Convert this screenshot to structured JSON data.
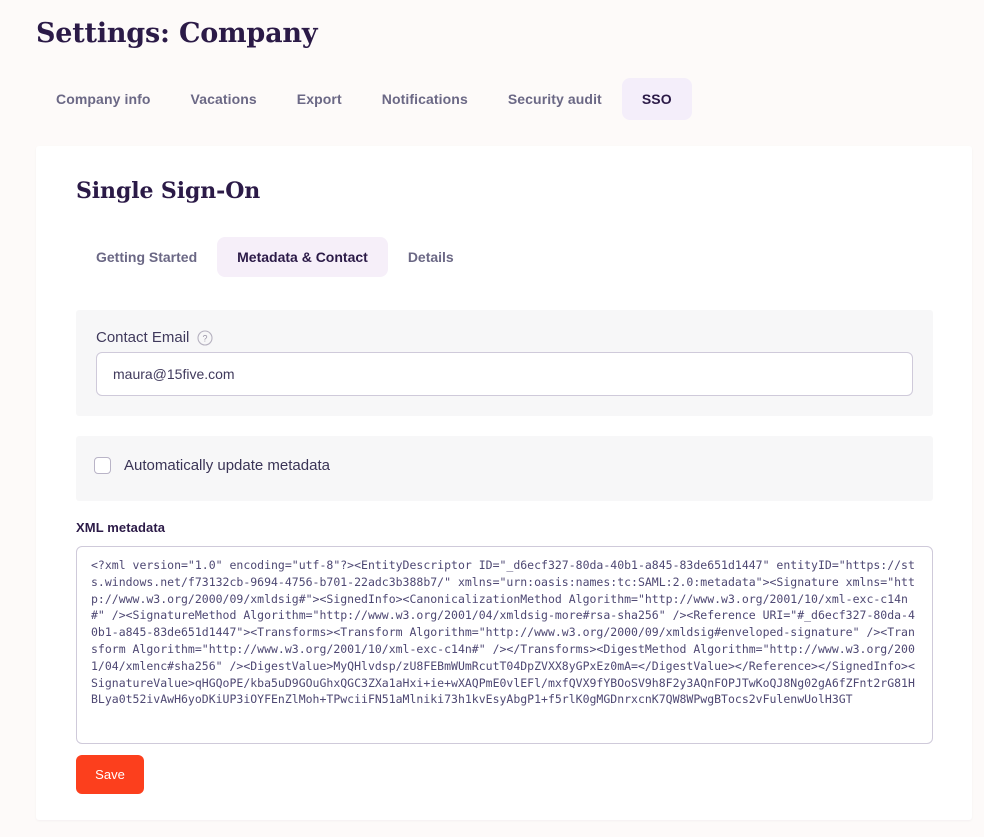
{
  "header": {
    "title": "Settings: Company",
    "tabs": [
      {
        "label": "Company info",
        "active": false
      },
      {
        "label": "Vacations",
        "active": false
      },
      {
        "label": "Export",
        "active": false
      },
      {
        "label": "Notifications",
        "active": false
      },
      {
        "label": "Security audit",
        "active": false
      },
      {
        "label": "SSO",
        "active": true
      }
    ]
  },
  "card": {
    "title": "Single Sign-On",
    "sub_tabs": [
      {
        "label": "Getting Started",
        "active": false
      },
      {
        "label": "Metadata & Contact",
        "active": true
      },
      {
        "label": "Details",
        "active": false
      }
    ],
    "contact_email": {
      "label": "Contact Email",
      "help_icon": "help-circle-icon",
      "value": "maura@15five.com",
      "placeholder": "Contact Email"
    },
    "auto_update": {
      "label": "Automatically update metadata",
      "checked": false
    },
    "xml_metadata": {
      "label": "XML metadata",
      "value": "<?xml version=\"1.0\" encoding=\"utf-8\"?><EntityDescriptor ID=\"_d6ecf327-80da-40b1-a845-83de651d1447\" entityID=\"https://sts.windows.net/f73132cb-9694-4756-b701-22adc3b388b7/\" xmlns=\"urn:oasis:names:tc:SAML:2.0:metadata\"><Signature xmlns=\"http://www.w3.org/2000/09/xmldsig#\"><SignedInfo><CanonicalizationMethod Algorithm=\"http://www.w3.org/2001/10/xml-exc-c14n#\" /><SignatureMethod Algorithm=\"http://www.w3.org/2001/04/xmldsig-more#rsa-sha256\" /><Reference URI=\"#_d6ecf327-80da-40b1-a845-83de651d1447\"><Transforms><Transform Algorithm=\"http://www.w3.org/2000/09/xmldsig#enveloped-signature\" /><Transform Algorithm=\"http://www.w3.org/2001/10/xml-exc-c14n#\" /></Transforms><DigestMethod Algorithm=\"http://www.w3.org/2001/04/xmlenc#sha256\" /><DigestValue>MyQHlvdsp/zU8FEBmWUmRcutT04DpZVXX8yGPxEz0mA=</DigestValue></Reference></SignedInfo><SignatureValue>qHGQoPE/kba5uD9GOuGhxQGC3ZXa1aHxi+ie+wXAQPmE0vlEFl/mxfQVX9fYBOoSV9h8F2y3AQnFOPJTwKoQJ8Ng02gA6fZFnt2rG81HBLya0t52ivAwH6yoDKiUP3iOYFEnZlMoh+TPwciiFN51aMlniki73h1kvEsyAbgP1+f5rlK0gMGDnrxcnK7QW8WPwgBTocs2vFulenwUolH3GT"
    },
    "save_label": "Save"
  },
  "colors": {
    "page_background": "#fdfaf9",
    "accent_tab": "#f4eefa",
    "title_text": "#2b1a47",
    "muted_text": "#6b6885",
    "panel_background": "#f7f7f8",
    "save_button": "#fc3f1d",
    "input_border": "#cfcada",
    "mono_text": "#4e4873"
  }
}
